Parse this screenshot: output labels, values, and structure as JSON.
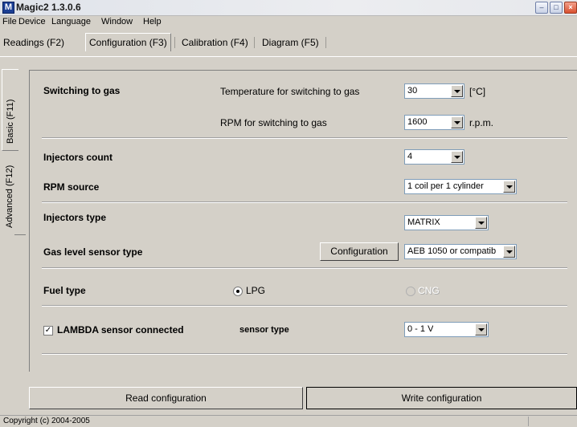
{
  "window": {
    "title": "Magic2 1.3.0.6",
    "icon_letter": "M"
  },
  "menu": [
    {
      "label": "File"
    },
    {
      "label": "Device"
    },
    {
      "label": "Language"
    },
    {
      "label": "Window"
    },
    {
      "label": "Help"
    }
  ],
  "tabs": [
    {
      "label": "Readings (F2)"
    },
    {
      "label": "Configuration (F3)",
      "active": true
    },
    {
      "label": "Calibration (F4)"
    },
    {
      "label": "Diagram (F5)"
    }
  ],
  "side_tabs": [
    {
      "label": "Basic (F11)",
      "active": true
    },
    {
      "label": "Advanced (F12)"
    }
  ],
  "config": {
    "switching": {
      "title": "Switching to gas",
      "temp_label": "Temperature for switching to gas",
      "temp_value": "30",
      "temp_unit": "[°C]",
      "rpm_label": "RPM for switching to gas",
      "rpm_value": "1600",
      "rpm_unit": "r.p.m."
    },
    "injectors_count": {
      "label": "Injectors count",
      "value": "4"
    },
    "rpm_source": {
      "label": "RPM source",
      "value": "1 coil per 1 cylinder"
    },
    "injectors_type": {
      "label": "Injectors type",
      "value": "MATRIX"
    },
    "gas_level": {
      "label": "Gas level sensor type",
      "button": "Configuration",
      "value": "AEB 1050 or compatib"
    },
    "fuel_type": {
      "label": "Fuel type",
      "option1": "LPG",
      "option2": "CNG",
      "selected": "LPG"
    },
    "lambda": {
      "label": "LAMBDA sensor connected",
      "checked": true,
      "check_glyph": "✓",
      "sensor_type_label": "sensor type",
      "sensor_type_value": "0 - 1 V"
    }
  },
  "actions": {
    "read": "Read configuration",
    "write": "Write configuration"
  },
  "status": {
    "text": "Copyright (c) 2004-2005"
  }
}
